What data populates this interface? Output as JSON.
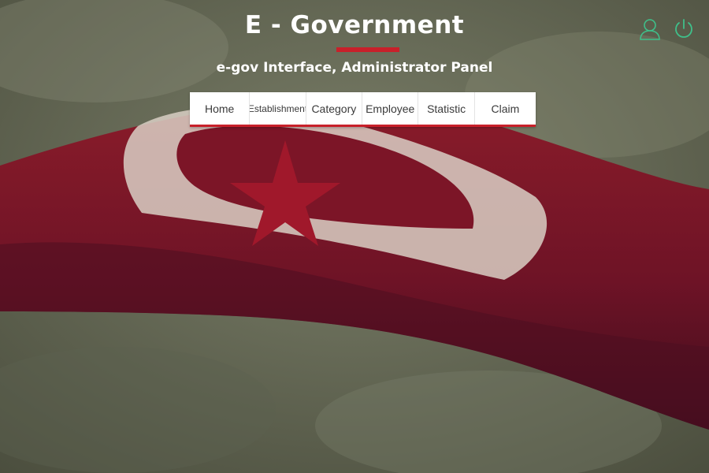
{
  "header": {
    "title": "E - Government",
    "subtitle": "e-gov Interface, Administrator Panel"
  },
  "icons": {
    "user": "user-icon",
    "power": "power-icon",
    "accent_color": "#3fbf8a"
  },
  "nav": {
    "items": [
      {
        "label": "Home"
      },
      {
        "label": "Establishment"
      },
      {
        "label": "Category"
      },
      {
        "label": "Employee"
      },
      {
        "label": "Statistic"
      },
      {
        "label": "Claim"
      }
    ]
  },
  "colors": {
    "brand_red": "#c8202a",
    "nav_background": "#ffffff"
  }
}
